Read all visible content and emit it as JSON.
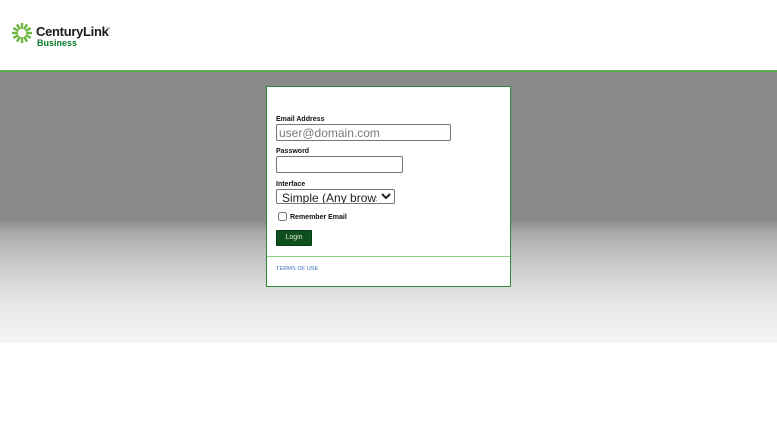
{
  "header": {
    "brand_name": "CenturyLink",
    "brand_tm": "™",
    "brand_sub": "Business",
    "logo_color": "#6ab43e"
  },
  "colors": {
    "accent_green": "#57b04a",
    "button_green": "#0e4f1e",
    "link_blue": "#3a6fbf"
  },
  "login": {
    "email_label": "Email Address",
    "email_value": "",
    "email_placeholder": "user@domain.com",
    "password_label": "Password",
    "password_value": "",
    "interface_label": "Interface",
    "interface_selected": "Simple (Any browser)",
    "remember_label": "Remember Email",
    "remember_checked": false,
    "login_button": "Login"
  },
  "footer": {
    "terms_link": "TERMS OF USE"
  }
}
